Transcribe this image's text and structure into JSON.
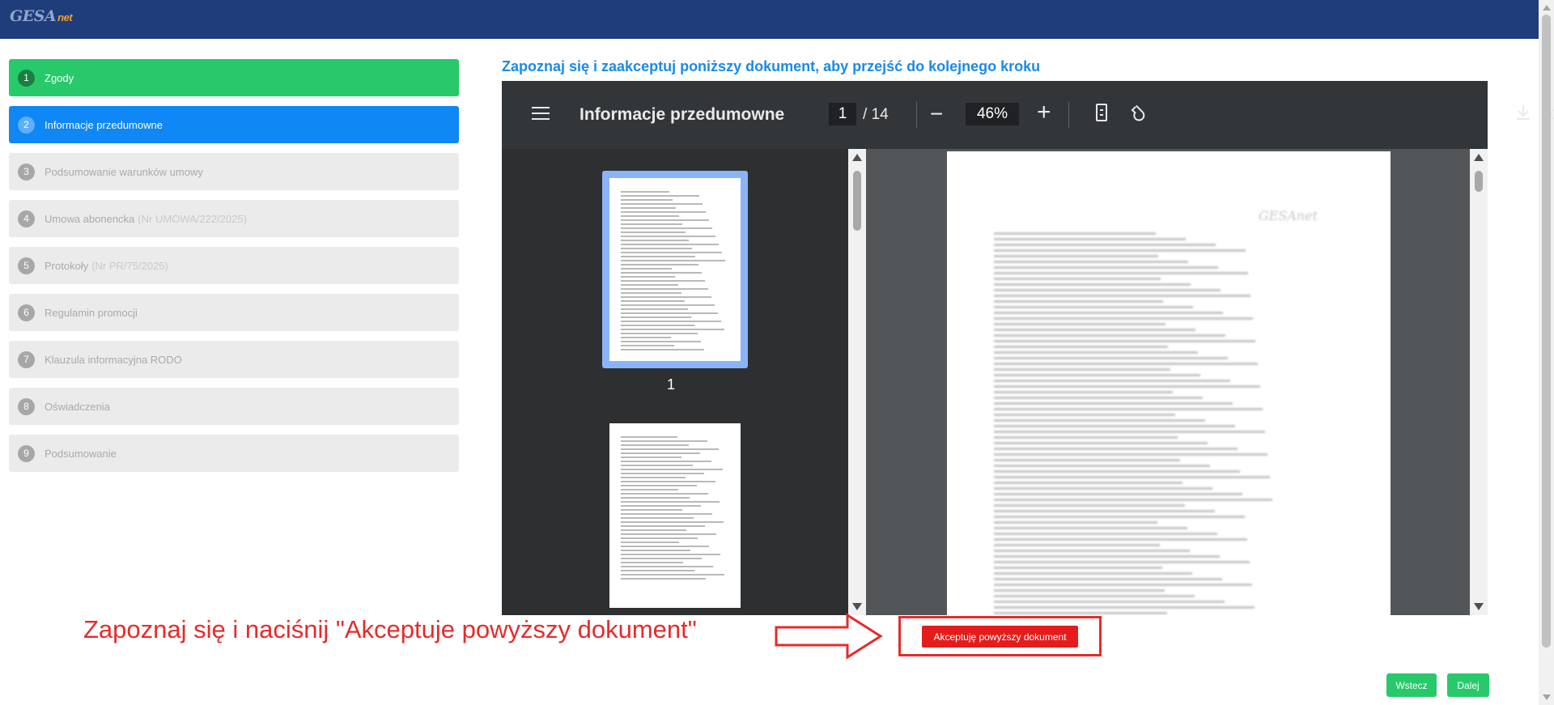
{
  "app": {
    "logo_main": "GESA",
    "logo_suffix": "net"
  },
  "steps": [
    {
      "num": "1",
      "label": "Zgody",
      "extra": "",
      "state": "done"
    },
    {
      "num": "2",
      "label": "Informacje przedumowne",
      "extra": "",
      "state": "active"
    },
    {
      "num": "3",
      "label": "Podsumowanie warunków umowy",
      "extra": "",
      "state": "disabled"
    },
    {
      "num": "4",
      "label": "Umowa abonencka",
      "extra": "(Nr UMOWA/222/2025)",
      "state": "disabled"
    },
    {
      "num": "5",
      "label": "Protokoły",
      "extra": "(Nr PR/75/2025)",
      "state": "disabled"
    },
    {
      "num": "6",
      "label": "Regulamin promocji",
      "extra": "",
      "state": "disabled"
    },
    {
      "num": "7",
      "label": "Klauzula informacyjna RODO",
      "extra": "",
      "state": "disabled"
    },
    {
      "num": "8",
      "label": "Oświadczenia",
      "extra": "",
      "state": "disabled"
    },
    {
      "num": "9",
      "label": "Podsumowanie",
      "extra": "",
      "state": "disabled"
    }
  ],
  "main": {
    "heading": "Zapoznaj się i zaakceptuj poniższy dokument, aby przejść do kolejnego kroku"
  },
  "viewer": {
    "title": "Informacje przedumowne",
    "current_page": "1",
    "page_separator": "/",
    "total_pages": "14",
    "zoom": "46%",
    "zoom_out": "−",
    "zoom_in": "+",
    "thumbnail_label": "1",
    "icons": [
      "menu-icon",
      "fit-page-icon",
      "rotate-icon",
      "download-icon",
      "print-icon",
      "more-icon"
    ]
  },
  "annotation": {
    "text": "Zapoznaj się i naciśnij \"Akceptuje powyższy dokument\""
  },
  "buttons": {
    "accept": "Akceptuję powyższy dokument",
    "back": "Wstecz",
    "next": "Dalej"
  },
  "colors": {
    "topbar": "#1f3d7a",
    "done": "#27c96b",
    "active": "#0f87f5",
    "accept": "#e41c1c",
    "annotation": "#e52b2b"
  }
}
